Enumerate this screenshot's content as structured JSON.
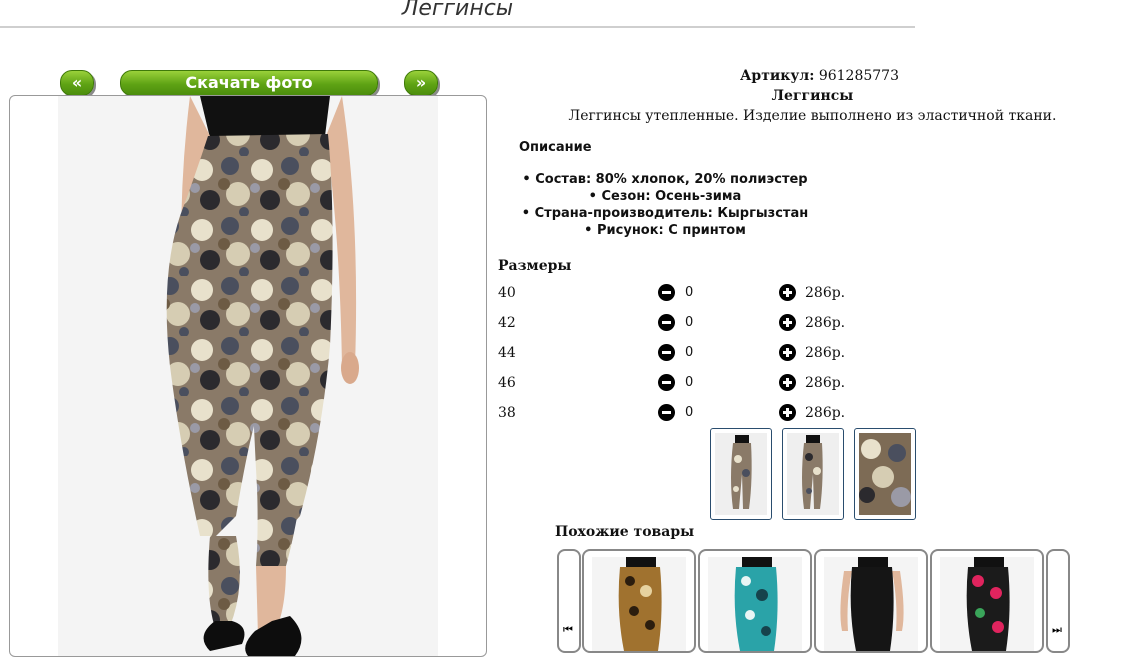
{
  "page": {
    "title": "Леггинсы"
  },
  "gallery": {
    "prev_label": "«",
    "download_label": "Скачать фото",
    "next_label": "»"
  },
  "product": {
    "sku_label": "Артикул:",
    "sku_value": "961285773",
    "name": "Леггинсы",
    "description": "Леггинсы утепленные. Изделие выполнено из эластичной ткани.",
    "description_heading": "Описание",
    "properties": [
      "Состав: 80% хлопок, 20% полиэстер",
      "Сезон: Осень-зима",
      "Страна-производитель: Кыргызстан",
      "Рисунок: С принтом"
    ]
  },
  "sizes": {
    "heading": "Размеры",
    "rows": [
      {
        "size": "40",
        "qty": "0",
        "price": "286р."
      },
      {
        "size": "42",
        "qty": "0",
        "price": "286р."
      },
      {
        "size": "44",
        "qty": "0",
        "price": "286р."
      },
      {
        "size": "46",
        "qty": "0",
        "price": "286р."
      },
      {
        "size": "38",
        "qty": "0",
        "price": "286р."
      }
    ]
  },
  "similar": {
    "heading": "Похожие товары",
    "prev_icon": "skip-back-icon",
    "next_icon": "skip-forward-icon",
    "prev_glyph": "⏮",
    "next_glyph": "⏭"
  },
  "colors": {
    "accent_green": "#5fa314",
    "thumb_border": "#2a4d6e"
  }
}
